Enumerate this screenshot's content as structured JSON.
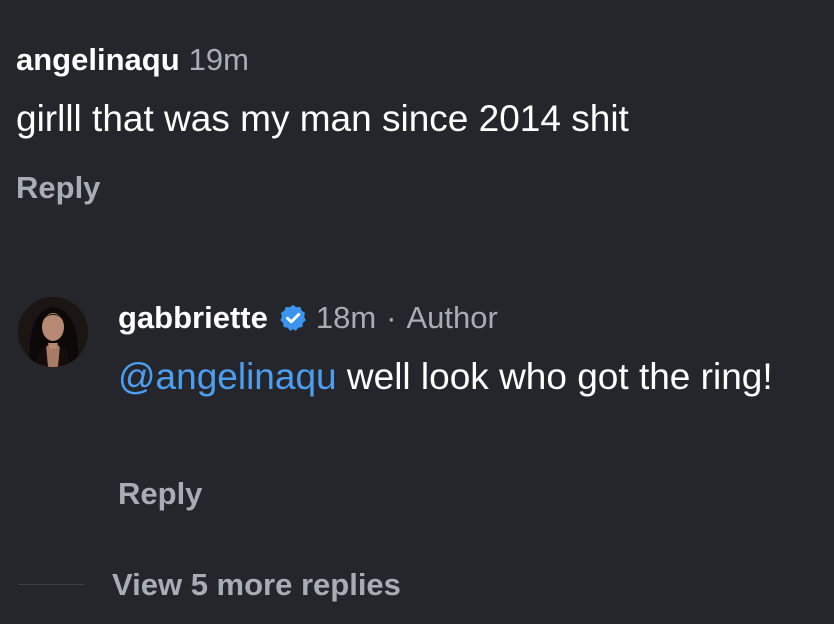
{
  "comment": {
    "username": "angelinaqu",
    "time": "19m",
    "text": "girlll that was my man since 2014 shit",
    "reply_label": "Reply"
  },
  "reply": {
    "username": "gabbriette",
    "verified_icon": "verified-badge-icon",
    "time": "18m",
    "separator": "·",
    "author_label": "Author",
    "mention": "@angelinaqu",
    "text": " well look who got the ring!",
    "reply_label": "Reply"
  },
  "view_more": "View 5 more replies",
  "colors": {
    "background": "#24262b",
    "text": "#ffffff",
    "secondary": "#a8acb3",
    "mention": "#4d9ef0",
    "verified": "#3b95f0"
  }
}
